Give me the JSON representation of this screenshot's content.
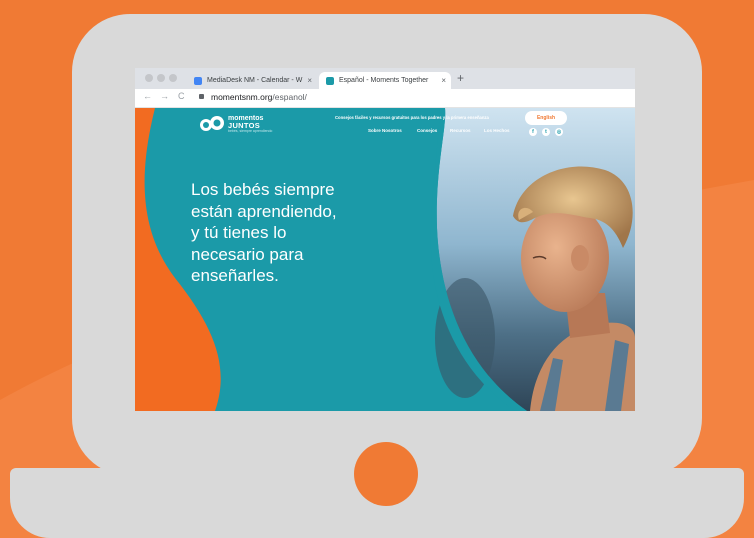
{
  "browser": {
    "tabs": [
      {
        "label": "MediaDesk NM - Calendar - W",
        "active": false
      },
      {
        "label": "Español - Moments Together",
        "active": true
      }
    ],
    "close_glyph": "×",
    "new_tab_glyph": "+",
    "nav": {
      "back": "←",
      "forward": "→",
      "reload": "C"
    },
    "address_host": "momentsnm.org",
    "address_path": "/espanol/"
  },
  "site": {
    "logo": {
      "line1": "momentos",
      "line2": "JUNTOS",
      "tag": "bebés, siempre aprendiendo"
    },
    "tagline": "Consejos fáciles y recursos gratuitos para los padres y la primera enseñanza",
    "english_button": "English",
    "nav_links": [
      "Sobre Nosotros",
      "Consejos",
      "Recursos",
      "Los Hechos"
    ],
    "social_icons": [
      "facebook-icon",
      "twitter-icon",
      "instagram-icon"
    ],
    "social_glyphs": [
      "f",
      "t",
      "◎"
    ],
    "headline": [
      "Los bebés siempre",
      "están aprendiendo,",
      "y tú tienes lo",
      "necesario para",
      "enseñarles."
    ]
  },
  "colors": {
    "background": "#f07a34",
    "laptop": "#d9d9d9",
    "site_teal": "#1b9aa8",
    "site_orange": "#f26b21"
  }
}
